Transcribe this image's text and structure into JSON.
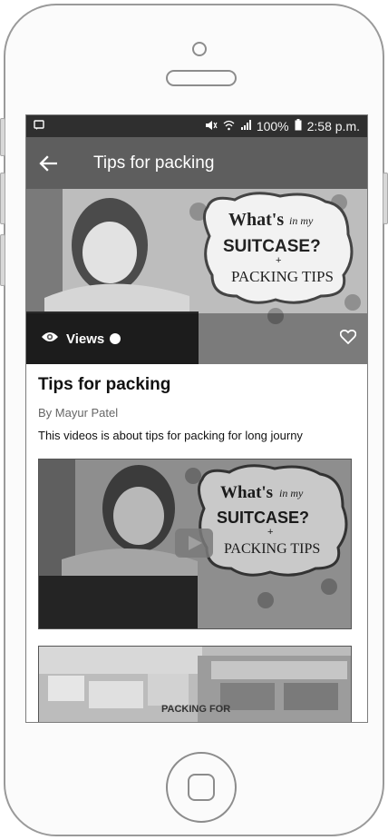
{
  "status": {
    "battery": "100%",
    "time": "2:58 p.m."
  },
  "appbar": {
    "title": "Tips for packing"
  },
  "hero": {
    "image_text": {
      "line1": "What's",
      "line1_small": "in my",
      "line2": "SUITCASE?",
      "plus": "+",
      "line3": "PACKING TIPS"
    },
    "views_label": "Views"
  },
  "post": {
    "title": "Tips for packing",
    "author": "By Mayur Patel",
    "description": "This videos is about tips for packing for long journy"
  },
  "cards": [
    {
      "image_text": {
        "line1": "What's",
        "line1_small": "in my",
        "line2": "SUITCASE?",
        "plus": "+",
        "line3": "PACKING TIPS"
      }
    },
    {
      "image_text": {
        "line1": "PACKING FOR"
      }
    }
  ],
  "icons": {
    "back": "arrow-left-icon",
    "views": "eye-icon",
    "favorite": "heart-icon",
    "play": "play-icon"
  }
}
